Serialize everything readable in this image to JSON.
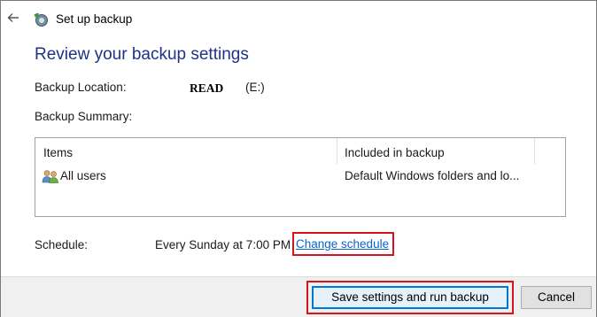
{
  "window": {
    "title": "Set up backup"
  },
  "heading": "Review your backup settings",
  "backup_location": {
    "label": "Backup Location:",
    "name": "READ",
    "drive": "(E:)"
  },
  "backup_summary": {
    "label": "Backup Summary:",
    "columns": [
      "Items",
      "Included in backup"
    ],
    "rows": [
      {
        "icon": "users-icon",
        "item": "All users",
        "included": "Default Windows folders and lo..."
      }
    ]
  },
  "schedule": {
    "label": "Schedule:",
    "value": "Every Sunday at 7:00 PM",
    "change_link": "Change schedule"
  },
  "buttons": {
    "save": "Save settings and run backup",
    "cancel": "Cancel"
  },
  "colors": {
    "heading": "#1e3287",
    "link": "#0a64c8",
    "highlight": "#d7141d",
    "primary_border": "#0078d7"
  }
}
